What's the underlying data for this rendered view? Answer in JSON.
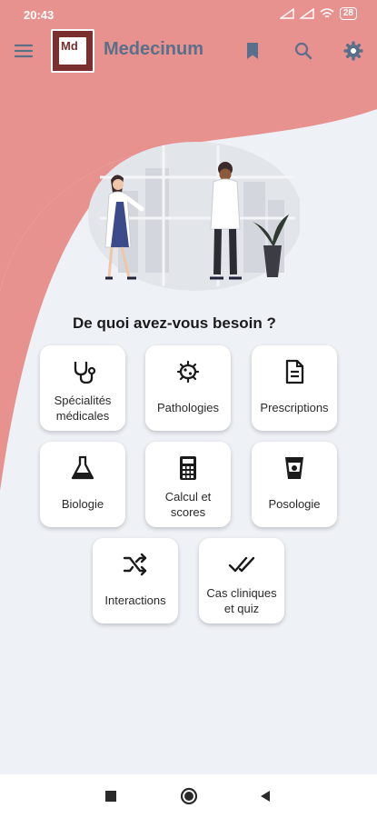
{
  "status": {
    "time": "20:43",
    "battery": "28"
  },
  "app": {
    "logo_text": "Md",
    "title": "Medecinum"
  },
  "colors": {
    "accent": "#e8928f",
    "title": "#5a6f8a",
    "icon": "#5a6f8a",
    "background": "#eef1f6"
  },
  "icons": {
    "menu": "menu-icon",
    "bookmark": "bookmark-icon",
    "search": "search-icon",
    "settings": "gear-icon",
    "nav": [
      "square-icon",
      "circle-icon",
      "back-triangle-icon"
    ]
  },
  "main": {
    "heading": "De quoi avez-vous besoin ?",
    "tiles": [
      {
        "label1": "Spécialités",
        "label2": "médicales",
        "icon": "stethoscope-icon"
      },
      {
        "label1": "Pathologies",
        "icon": "bacteria-icon"
      },
      {
        "label1": "Prescriptions",
        "icon": "document-icon"
      },
      {
        "label1": "Biologie",
        "icon": "flask-icon"
      },
      {
        "label1": "Calcul et",
        "label2": "scores",
        "icon": "calculator-icon"
      },
      {
        "label1": "Posologie",
        "icon": "cup-icon"
      },
      {
        "label1": "Interactions",
        "icon": "shuffle-icon"
      },
      {
        "label1": "Cas cliniques",
        "label2": "et quiz",
        "icon": "double-check-icon"
      }
    ]
  }
}
